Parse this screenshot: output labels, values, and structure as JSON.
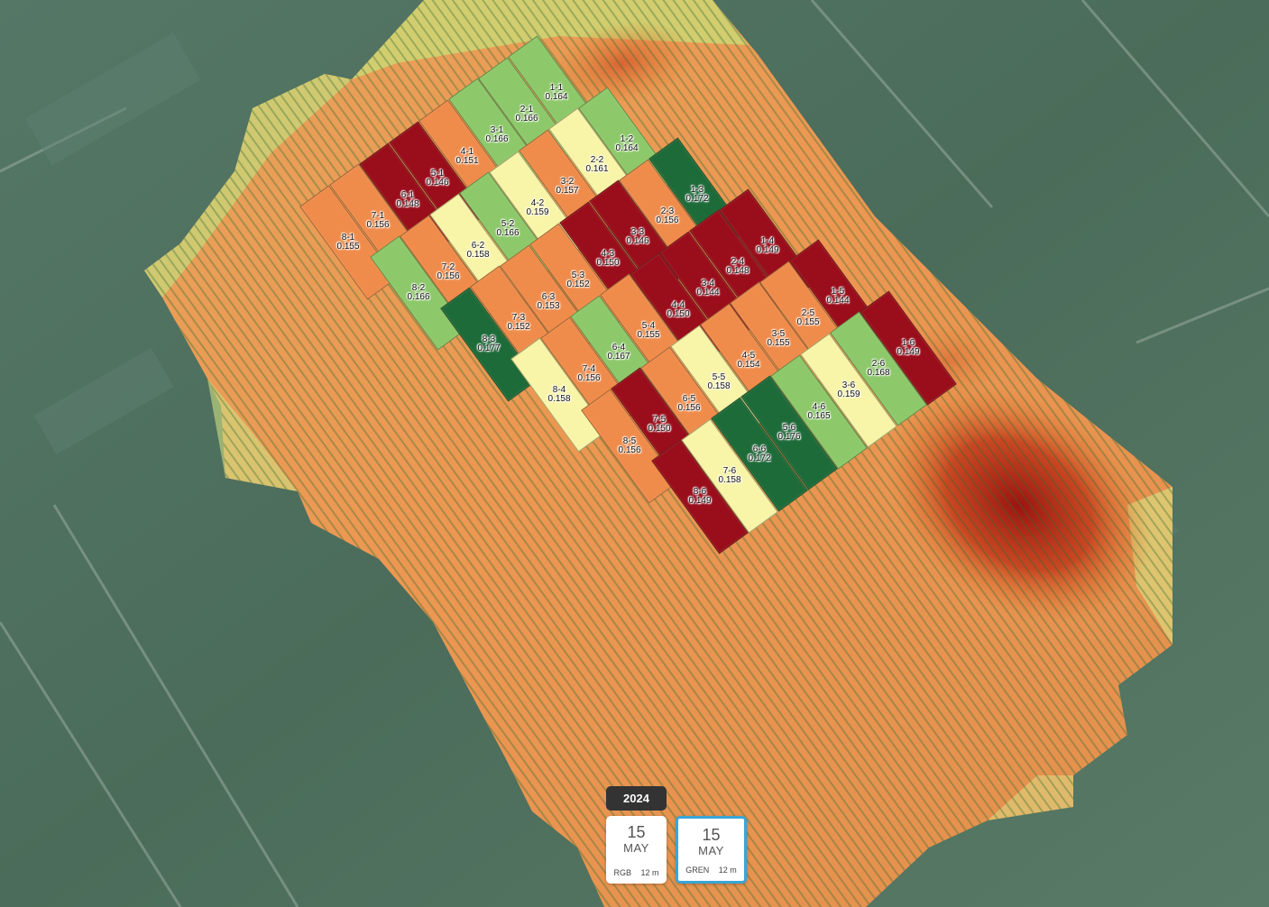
{
  "map": {
    "legend_colors": {
      "dark_red": "#9a0d1b",
      "orange": "#f08c4b",
      "light_yellow": "#f8f5a8",
      "light_green": "#8dc96a",
      "dark_green": "#1e6b3a"
    },
    "plots": [
      {
        "id": "1-1",
        "value": "0.164",
        "color": "#8dc96a"
      },
      {
        "id": "2-1",
        "value": "0.166",
        "color": "#8dc96a"
      },
      {
        "id": "3-1",
        "value": "0.166",
        "color": "#8dc96a"
      },
      {
        "id": "4-1",
        "value": "0.151",
        "color": "#f08c4b"
      },
      {
        "id": "5-1",
        "value": "0.146",
        "color": "#9a0d1b"
      },
      {
        "id": "6-1",
        "value": "0.148",
        "color": "#9a0d1b"
      },
      {
        "id": "7-1",
        "value": "0.156",
        "color": "#f08c4b"
      },
      {
        "id": "8-1",
        "value": "0.155",
        "color": "#f08c4b"
      },
      {
        "id": "1-2",
        "value": "0.164",
        "color": "#8dc96a"
      },
      {
        "id": "2-2",
        "value": "0.161",
        "color": "#f8f5a8"
      },
      {
        "id": "3-2",
        "value": "0.157",
        "color": "#f08c4b"
      },
      {
        "id": "4-2",
        "value": "0.159",
        "color": "#f8f5a8"
      },
      {
        "id": "5-2",
        "value": "0.166",
        "color": "#8dc96a"
      },
      {
        "id": "6-2",
        "value": "0.158",
        "color": "#f8f5a8"
      },
      {
        "id": "7-2",
        "value": "0.156",
        "color": "#f08c4b"
      },
      {
        "id": "8-2",
        "value": "0.166",
        "color": "#8dc96a"
      },
      {
        "id": "1-3",
        "value": "0.172",
        "color": "#1e6b3a"
      },
      {
        "id": "2-3",
        "value": "0.156",
        "color": "#f08c4b"
      },
      {
        "id": "3-3",
        "value": "0.146",
        "color": "#9a0d1b"
      },
      {
        "id": "4-3",
        "value": "0.150",
        "color": "#9a0d1b"
      },
      {
        "id": "5-3",
        "value": "0.152",
        "color": "#f08c4b"
      },
      {
        "id": "6-3",
        "value": "0.153",
        "color": "#f08c4b"
      },
      {
        "id": "7-3",
        "value": "0.152",
        "color": "#f08c4b"
      },
      {
        "id": "8-3",
        "value": "0.177",
        "color": "#1e6b3a"
      },
      {
        "id": "1-4",
        "value": "0.149",
        "color": "#9a0d1b"
      },
      {
        "id": "2-4",
        "value": "0.148",
        "color": "#9a0d1b"
      },
      {
        "id": "3-4",
        "value": "0.144",
        "color": "#9a0d1b"
      },
      {
        "id": "4-4",
        "value": "0.150",
        "color": "#9a0d1b"
      },
      {
        "id": "5-4",
        "value": "0.155",
        "color": "#f08c4b"
      },
      {
        "id": "6-4",
        "value": "0.167",
        "color": "#8dc96a"
      },
      {
        "id": "7-4",
        "value": "0.156",
        "color": "#f08c4b"
      },
      {
        "id": "8-4",
        "value": "0.158",
        "color": "#f8f5a8"
      },
      {
        "id": "1-5",
        "value": "0.144",
        "color": "#9a0d1b"
      },
      {
        "id": "2-5",
        "value": "0.155",
        "color": "#f08c4b"
      },
      {
        "id": "3-5",
        "value": "0.155",
        "color": "#f08c4b"
      },
      {
        "id": "4-5",
        "value": "0.154",
        "color": "#f08c4b"
      },
      {
        "id": "5-5",
        "value": "0.158",
        "color": "#f8f5a8"
      },
      {
        "id": "6-5",
        "value": "0.156",
        "color": "#f08c4b"
      },
      {
        "id": "7-5",
        "value": "0.150",
        "color": "#9a0d1b"
      },
      {
        "id": "8-5",
        "value": "0.156",
        "color": "#f08c4b"
      },
      {
        "id": "1-6",
        "value": "0.149",
        "color": "#9a0d1b"
      },
      {
        "id": "2-6",
        "value": "0.168",
        "color": "#8dc96a"
      },
      {
        "id": "3-6",
        "value": "0.159",
        "color": "#f8f5a8"
      },
      {
        "id": "4-6",
        "value": "0.165",
        "color": "#8dc96a"
      },
      {
        "id": "5-6",
        "value": "0.176",
        "color": "#1e6b3a"
      },
      {
        "id": "6-6",
        "value": "0.172",
        "color": "#1e6b3a"
      },
      {
        "id": "7-6",
        "value": "0.158",
        "color": "#f8f5a8"
      },
      {
        "id": "8-6",
        "value": "0.149",
        "color": "#9a0d1b"
      }
    ]
  },
  "timeline": {
    "year": "2024",
    "dates": [
      {
        "day": "15",
        "month": "MAY",
        "layer": "RGB",
        "altitude": "12 m",
        "selected": false
      },
      {
        "day": "15",
        "month": "MAY",
        "layer": "GREN",
        "altitude": "12 m",
        "selected": true
      }
    ]
  }
}
